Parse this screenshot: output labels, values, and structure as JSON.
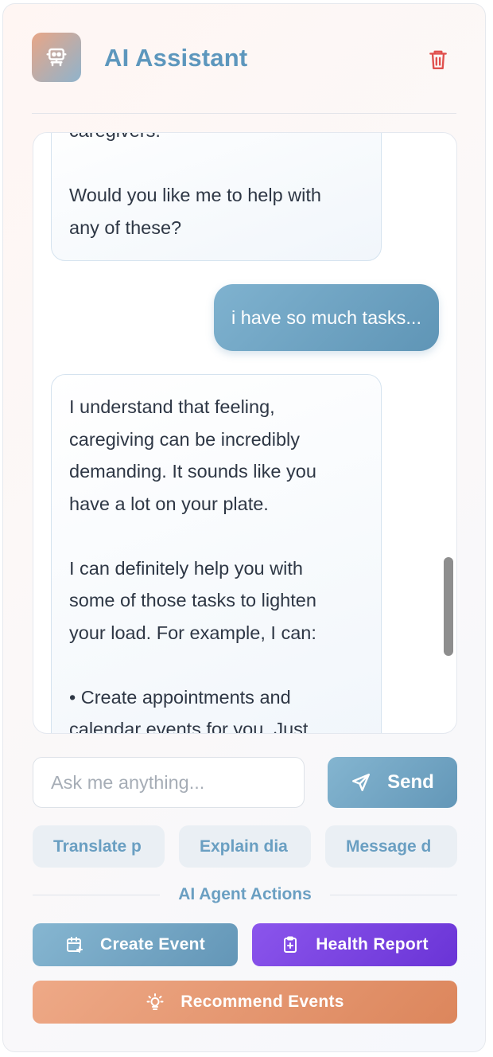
{
  "header": {
    "title": "AI Assistant",
    "avatar_icon": "robot-icon",
    "clear_icon": "trash-icon",
    "accent_color": "#5d97bd",
    "danger_color": "#e0504d"
  },
  "messages": [
    {
      "role": "assistant",
      "text": "caregivers.\n\nWould you like me to help with\nany of these?"
    },
    {
      "role": "user",
      "text": "i have so much tasks..."
    },
    {
      "role": "assistant",
      "text": "I understand that feeling,\ncaregiving can be incredibly\ndemanding. It sounds like you\nhave a lot on your plate.\n\nI can definitely help you with\nsome of those tasks to lighten\nyour load. For example, I can:\n\n• Create appointments and\ncalendar events for you. Just"
    }
  ],
  "composer": {
    "placeholder": "Ask me anything...",
    "send_label": "Send",
    "send_icon": "paper-plane-icon"
  },
  "quick_prompts": [
    "Translate p",
    "Explain dia",
    "Message d"
  ],
  "agent_actions": {
    "section_label": "AI Agent Actions",
    "create_event": {
      "label": "Create Event",
      "icon": "calendar-plus-icon",
      "color": "#6f9fbf"
    },
    "health_report": {
      "label": "Health Report",
      "icon": "clipboard-plus-icon",
      "color": "#7a45e2"
    },
    "recommend_events": {
      "label": "Recommend Events",
      "icon": "lightbulb-icon",
      "color": "#e69770"
    }
  }
}
